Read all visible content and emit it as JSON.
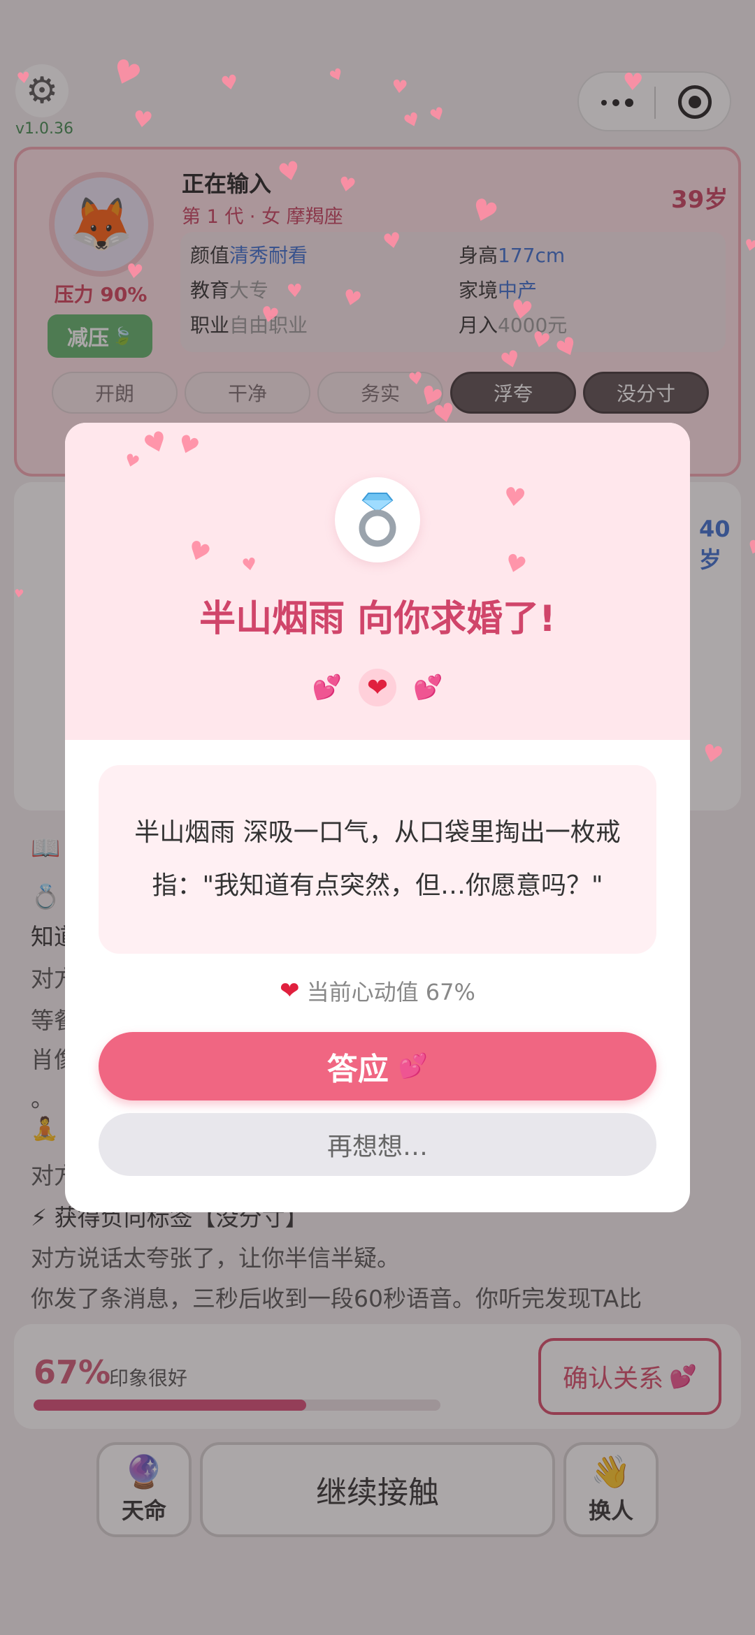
{
  "version": "v1.0.36",
  "partner_card": {
    "name": "正在输入",
    "subtitle": "第 1 代 · 女 摩羯座",
    "age": "39岁",
    "stress": "压力 90%",
    "relax_label": "减压",
    "attributes": [
      {
        "label": "颜值",
        "value": "清秀耐看",
        "style": "blue"
      },
      {
        "label": "身高",
        "value": "177cm",
        "style": "blue"
      },
      {
        "label": "教育",
        "value": "大专",
        "style": "grey"
      },
      {
        "label": "家境",
        "value": "中产",
        "style": "blue"
      },
      {
        "label": "职业",
        "value": "自由职业",
        "style": "grey"
      },
      {
        "label": "月入",
        "value": "4000元",
        "style": "grey"
      }
    ],
    "tags": [
      {
        "label": "开朗",
        "kind": "pos"
      },
      {
        "label": "干净",
        "kind": "pos"
      },
      {
        "label": "务实",
        "kind": "pos"
      },
      {
        "label": "浮夸",
        "kind": "neg"
      },
      {
        "label": "没分寸",
        "kind": "neg"
      }
    ]
  },
  "second_card": {
    "age": "40岁"
  },
  "log": {
    "lines": [
      {
        "text": "知道",
        "style": "dark"
      },
      {
        "text": "对方",
        "style": "muted"
      },
      {
        "text": "等餐",
        "style": "muted"
      },
      {
        "text": "肖像",
        "style": "muted"
      },
      {
        "text": "。",
        "style": "muted"
      },
      {
        "text": "对方",
        "style": "muted"
      },
      {
        "text": "⚡ 获得负向标签【没分寸】",
        "style": "tag"
      },
      {
        "text": "对方说话太夸张了，让你半信半疑。",
        "style": "muted"
      },
      {
        "text": "你发了条消息，三秒后收到一段60秒语音。你听完发现TA比",
        "style": "muted"
      }
    ]
  },
  "progress": {
    "percent_label": "67%",
    "desc": "印象很好",
    "value": 0.67,
    "confirm_label": "确认关系"
  },
  "bottom": {
    "fate_label": "天命",
    "continue_label": "继续接触",
    "swap_label": "换人"
  },
  "modal": {
    "title": "半山烟雨 向你求婚了!",
    "message": "半山烟雨 深吸一口气，从口袋里掏出一枚戒指：\"我知道有点突然，但…你愿意吗？\"",
    "heart_value": "当前心动值 67%",
    "accept_label": "答应",
    "think_label": "再想想…"
  },
  "colors": {
    "accent_pink": "#f06682",
    "title_pink": "#d0456a",
    "overlay": "rgba(55,45,48,0.42)",
    "relax_green": "#5fb46b"
  },
  "icons": {
    "settings": "gear-icon",
    "ring": "ring-icon",
    "avatar": "fox-avatar-icon",
    "fate": "crystal-ball-icon",
    "swap": "waving-hands-icon"
  }
}
